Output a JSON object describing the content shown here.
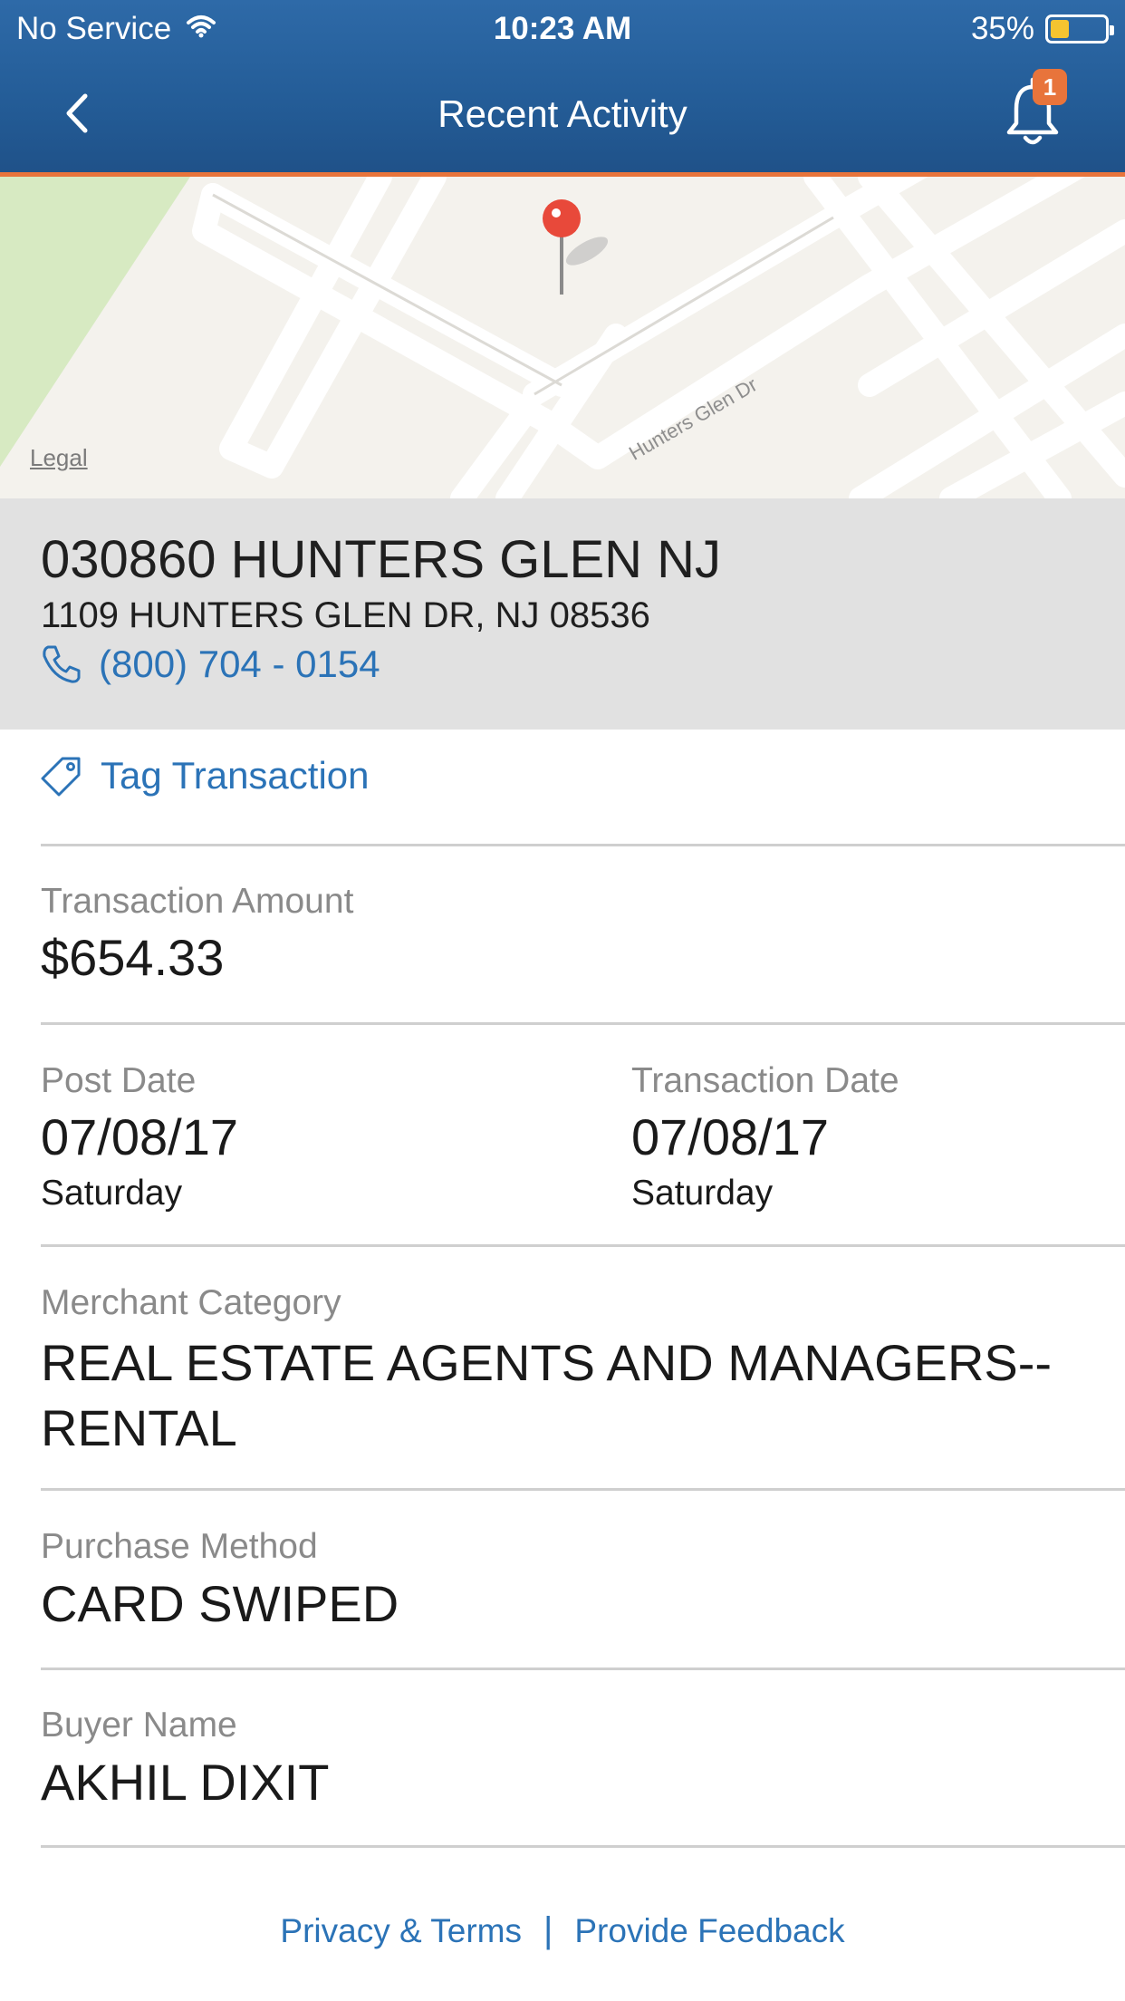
{
  "status_bar": {
    "carrier": "No Service",
    "time": "10:23 AM",
    "battery_percent": "35%",
    "battery_level": 0.35
  },
  "nav": {
    "title": "Recent Activity",
    "back_icon": "chevron-left-icon",
    "bell_icon": "bell-icon",
    "notification_count": "1"
  },
  "map": {
    "legal_label": "Legal",
    "street_label": "Hunters Glen Dr",
    "pin_icon": "map-pin-icon"
  },
  "merchant": {
    "name": "030860 HUNTERS GLEN NJ",
    "address": "1109 HUNTERS GLEN DR, NJ 08536",
    "phone": "(800) 704 - 0154"
  },
  "actions": {
    "tag_label": "Tag Transaction"
  },
  "details": {
    "amount_label": "Transaction Amount",
    "amount_value": "$654.33",
    "post_date_label": "Post Date",
    "post_date_value": "07/08/17",
    "post_date_day": "Saturday",
    "transaction_date_label": "Transaction Date",
    "transaction_date_value": "07/08/17",
    "transaction_date_day": "Saturday",
    "merchant_category_label": "Merchant Category",
    "merchant_category_value": "REAL ESTATE AGENTS AND MANAGERS--RENTAL",
    "purchase_method_label": "Purchase Method",
    "purchase_method_value": "CARD SWIPED",
    "buyer_name_label": "Buyer Name",
    "buyer_name_value": "AKHIL DIXIT"
  },
  "footer": {
    "privacy_label": "Privacy & Terms",
    "separator": "|",
    "feedback_label": "Provide Feedback"
  },
  "colors": {
    "header_blue": "#245d98",
    "accent_orange": "#e8743b",
    "link_blue": "#2b73b7",
    "merchant_bg": "#e1e1e1"
  }
}
